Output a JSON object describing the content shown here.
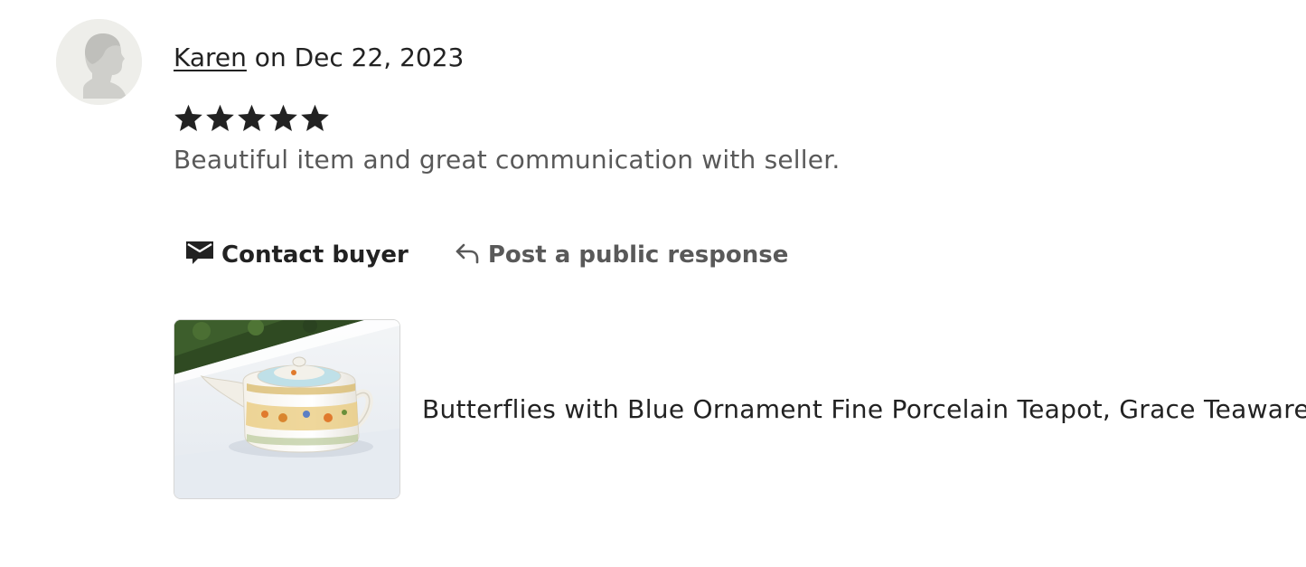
{
  "review": {
    "author": "Karen",
    "date_text": " on Dec 22, 2023",
    "rating": 5,
    "rating_max": 5,
    "text": "Beautiful item and great communication with seller."
  },
  "actions": {
    "contact_label": "Contact buyer",
    "respond_label": "Post a public response"
  },
  "product": {
    "title": "Butterflies with Blue Ornament Fine Porcelain Teapot, Grace Teaware"
  },
  "icons": {
    "avatar": "user-avatar-icon",
    "star": "star-icon",
    "contact": "envelope-icon",
    "respond": "reply-arrow-icon"
  },
  "colors": {
    "text_primary": "#222222",
    "text_secondary": "#595959",
    "avatar_bg": "#eeeeea",
    "star": "#222222"
  }
}
